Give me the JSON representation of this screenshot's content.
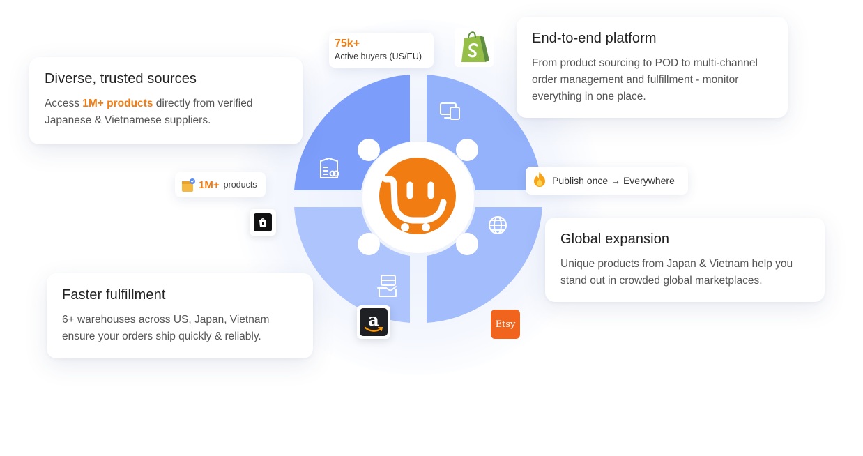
{
  "cards": {
    "sources": {
      "title": "Diverse, trusted sources",
      "text_before": "Access ",
      "highlight": "1M+ products",
      "text_after": " directly from verified Japanese & Vietnamese suppliers."
    },
    "platform": {
      "title": "End-to-end platform",
      "text": "From product sourcing to POD to multi-channel order management and fulfillment - monitor everything in one place."
    },
    "global": {
      "title": "Global expansion",
      "text": "Unique products from Japan & Vietnam help you stand out in crowded global marketplaces."
    },
    "fulfillment": {
      "title": "Faster fulfillment",
      "text": "6+ warehouses across US, Japan, Vietnam ensure your orders ship quickly & reliably."
    }
  },
  "badges": {
    "buyers": {
      "value": "75k+",
      "label": "Active buyers (US/EU)"
    },
    "products": {
      "value": "1M+",
      "label": "products"
    },
    "publish": {
      "text": "Publish once → Everywhere"
    }
  },
  "logos": {
    "etsy": "Etsy",
    "amazon": "a"
  },
  "icons": [
    "box-icon",
    "store-icon",
    "devices-icon",
    "globe-icon",
    "delivery-icon",
    "cart-smile-logo",
    "shopify-icon",
    "amazon-icon",
    "etsy-icon",
    "shop-bag-icon",
    "fire-icon"
  ],
  "colors": {
    "accent": "#f07c12",
    "quadrant_dark": "#7c9dfa",
    "quadrant_mid": "#94b2fb",
    "quadrant_light": "#a9c1fc",
    "shopify": "#95bf47",
    "etsy": "#f1641e"
  }
}
